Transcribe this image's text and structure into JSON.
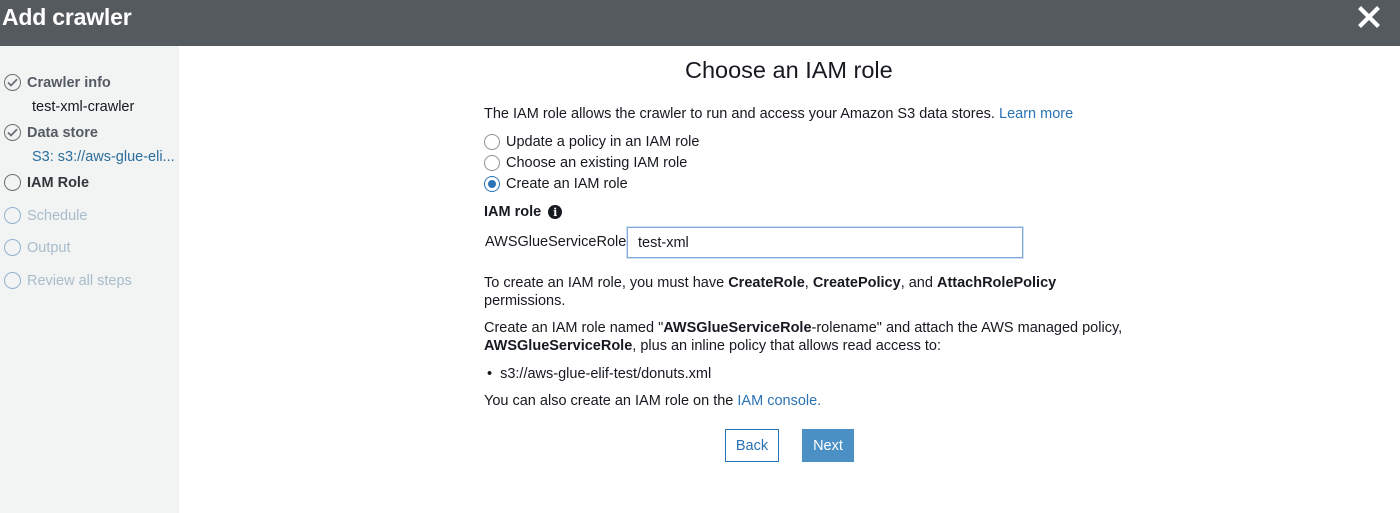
{
  "header": {
    "title": "Add crawler"
  },
  "sidebar": {
    "steps": [
      {
        "label": "Crawler info",
        "sub": "test-xml-crawler",
        "status": "complete"
      },
      {
        "label": "Data store",
        "sub": "S3: s3://aws-glue-eli...",
        "status": "complete"
      },
      {
        "label": "IAM Role",
        "status": "current"
      },
      {
        "label": "Schedule",
        "status": "disabled"
      },
      {
        "label": "Output",
        "status": "disabled"
      },
      {
        "label": "Review all steps",
        "status": "disabled"
      }
    ]
  },
  "main": {
    "title": "Choose an IAM role",
    "intro": "The IAM role allows the crawler to run and access your Amazon S3 data stores.",
    "learn_more": "Learn more",
    "options": [
      {
        "label": "Update a policy in an IAM role",
        "checked": false
      },
      {
        "label": "Choose an existing IAM role",
        "checked": false
      },
      {
        "label": "Create an IAM role",
        "checked": true
      }
    ],
    "iam_role_label": "IAM role",
    "prefix": "AWSGlueServiceRole-",
    "role_value": "test-xml",
    "perm_text_1": "To create an IAM role, you must have",
    "perm_create_role": "CreateRole",
    "perm_sep_1": ",",
    "perm_create_policy": "CreatePolicy",
    "perm_sep_2": ", and",
    "perm_attach": "AttachRolePolicy",
    "perm_text_2": "permissions.",
    "create_text_1": "Create an IAM role named \"",
    "create_bold_name": "AWSGlueServiceRole",
    "create_text_2": "-rolename\" and attach the AWS managed policy,",
    "create_bold_policy": "AWSGlueServiceRole",
    "create_text_3": ", plus an inline policy that allows read access to:",
    "bullet_path": "s3://aws-glue-elif-test/donuts.xml",
    "console_text": "You can also create an IAM role on the",
    "console_link": "IAM console.",
    "back_label": "Back",
    "next_label": "Next"
  },
  "colors": {
    "header": "#555a5f",
    "accent": "#2a73b5",
    "next": "#4a90c4"
  }
}
